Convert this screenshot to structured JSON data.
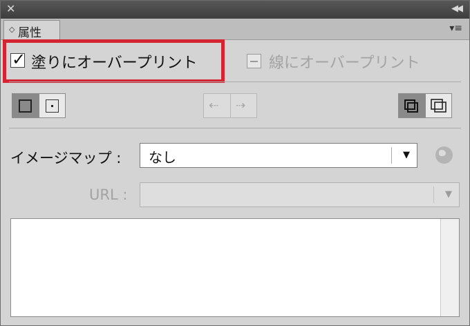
{
  "window": {
    "close_glyph": "✕",
    "collapse_glyph": "◀◀"
  },
  "tab": {
    "arrow": "◇",
    "label": "属性",
    "menu_glyph": "▾≡"
  },
  "overprint": {
    "fill_label": "塗りにオーバープリント",
    "fill_checked": true,
    "stroke_label": "線にオーバープリント",
    "stroke_checked": false
  },
  "image_map": {
    "label": "イメージマップ :",
    "value": "なし"
  },
  "url": {
    "label": "URL :",
    "value": ""
  },
  "icons": {
    "check": "✓",
    "dropdown_arrow": "▼",
    "arrow_left": "⇠",
    "arrow_right": "⇢"
  },
  "colors": {
    "highlight": "#d42331",
    "panel_bg": "#d4d4d4",
    "titlebar": "#444444"
  }
}
